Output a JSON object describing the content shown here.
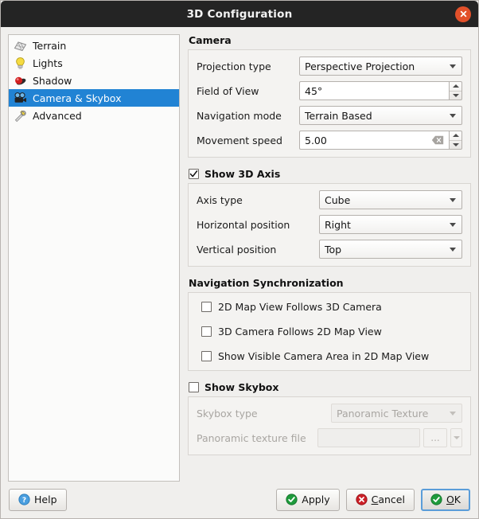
{
  "window": {
    "title": "3D Configuration",
    "close_icon": "close-icon",
    "accent_close": "#e2502a",
    "selection_color": "#2183d4"
  },
  "sidebar": {
    "items": [
      {
        "label": "Terrain",
        "icon": "terrain-icon",
        "selected": false
      },
      {
        "label": "Lights",
        "icon": "lightbulb-icon",
        "selected": false
      },
      {
        "label": "Shadow",
        "icon": "shadow-icon",
        "selected": false
      },
      {
        "label": "Camera & Skybox",
        "icon": "camera-icon",
        "selected": true
      },
      {
        "label": "Advanced",
        "icon": "tools-icon",
        "selected": false
      }
    ]
  },
  "camera": {
    "title": "Camera",
    "projection_type": {
      "label": "Projection type",
      "value": "Perspective Projection"
    },
    "field_of_view": {
      "label": "Field of View",
      "value": "45°"
    },
    "navigation_mode": {
      "label": "Navigation mode",
      "value": "Terrain Based"
    },
    "movement_speed": {
      "label": "Movement speed",
      "value": "5.00",
      "clear_icon": "clear-icon"
    }
  },
  "axis": {
    "title": "Show 3D Axis",
    "checked": true,
    "axis_type": {
      "label": "Axis type",
      "value": "Cube"
    },
    "horizontal_position": {
      "label": "Horizontal position",
      "value": "Right"
    },
    "vertical_position": {
      "label": "Vertical position",
      "value": "Top"
    }
  },
  "navsync": {
    "title": "Navigation Synchronization",
    "options": [
      {
        "label": "2D Map View Follows 3D Camera",
        "checked": false
      },
      {
        "label": "3D Camera Follows 2D Map View",
        "checked": false
      },
      {
        "label": "Show Visible Camera Area in 2D Map View",
        "checked": false
      }
    ]
  },
  "skybox": {
    "title": "Show Skybox",
    "checked": false,
    "skybox_type": {
      "label": "Skybox type",
      "value": "Panoramic Texture"
    },
    "texture_file": {
      "label": "Panoramic texture file",
      "value": "",
      "browse_label": "..."
    }
  },
  "footer": {
    "help": {
      "label": "Help",
      "icon": "help-icon"
    },
    "apply": {
      "label": "Apply",
      "icon": "check-icon"
    },
    "cancel": {
      "label": "Cancel",
      "icon": "cancel-icon",
      "mnemonic": "C",
      "rest": "ancel"
    },
    "ok": {
      "label": "OK",
      "icon": "check-icon",
      "mnemonic": "O",
      "rest": "K",
      "focused": true
    }
  }
}
